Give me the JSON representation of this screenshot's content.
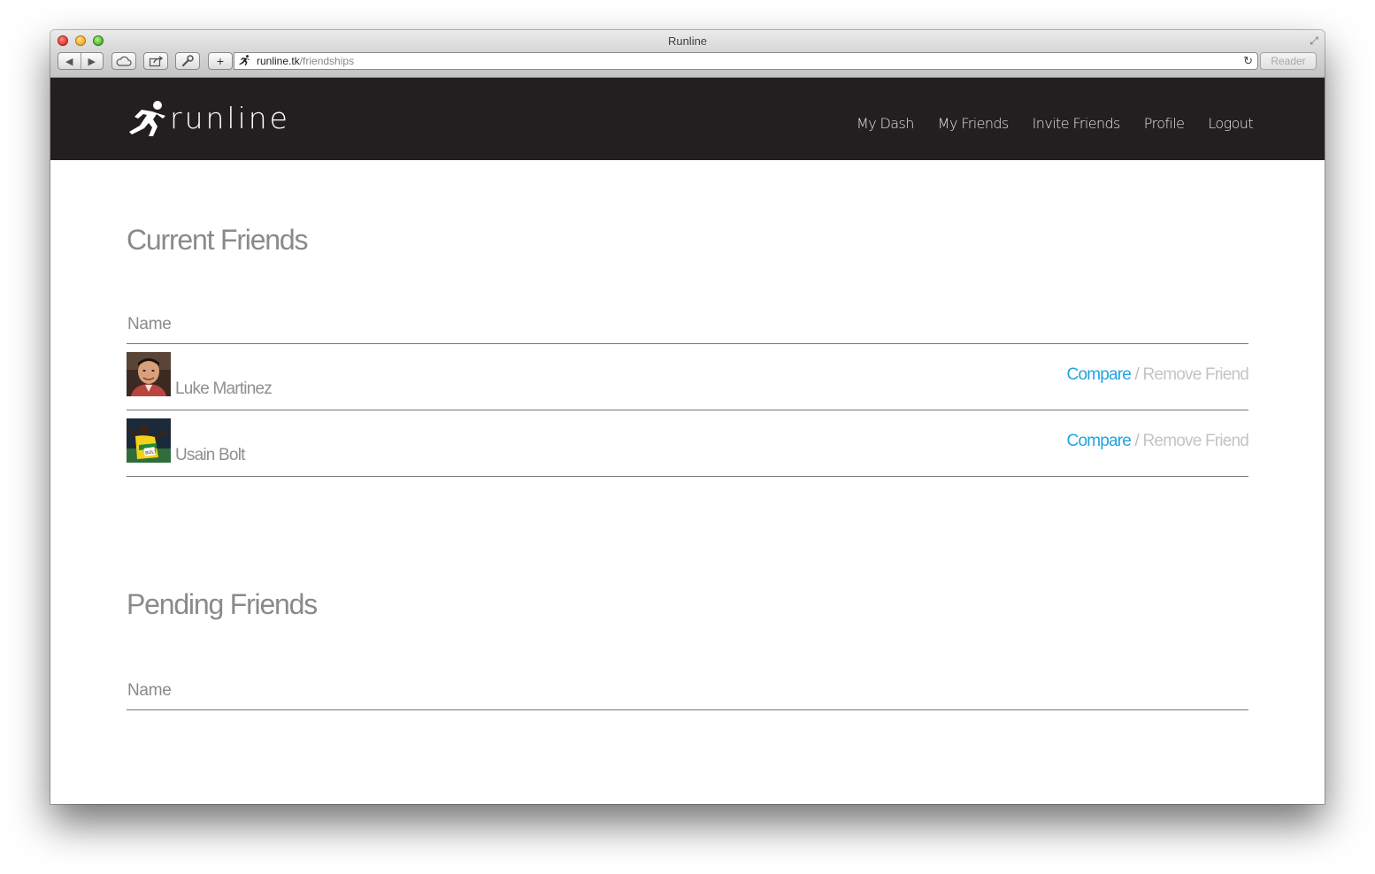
{
  "browser": {
    "window_title": "Runline",
    "url_host": "runline.tk",
    "url_path": "/friendships",
    "reader_label": "Reader",
    "add_label": "+"
  },
  "site": {
    "logo_text": "runline",
    "nav": [
      "My Dash",
      "My Friends",
      "Invite Friends",
      "Profile",
      "Logout"
    ]
  },
  "current_friends": {
    "title": "Current Friends",
    "column_name": "Name",
    "rows": [
      {
        "name": "Luke Martinez",
        "compare_label": "Compare",
        "separator": " / ",
        "remove_label": "Remove Friend"
      },
      {
        "name": "Usain Bolt",
        "compare_label": "Compare",
        "separator": " / ",
        "remove_label": "Remove Friend"
      }
    ]
  },
  "pending_friends": {
    "title": "Pending Friends",
    "column_name": "Name"
  },
  "colors": {
    "header_bg": "#231f20",
    "link_blue": "#1fa3dd",
    "muted_text": "#8a8a8a"
  }
}
